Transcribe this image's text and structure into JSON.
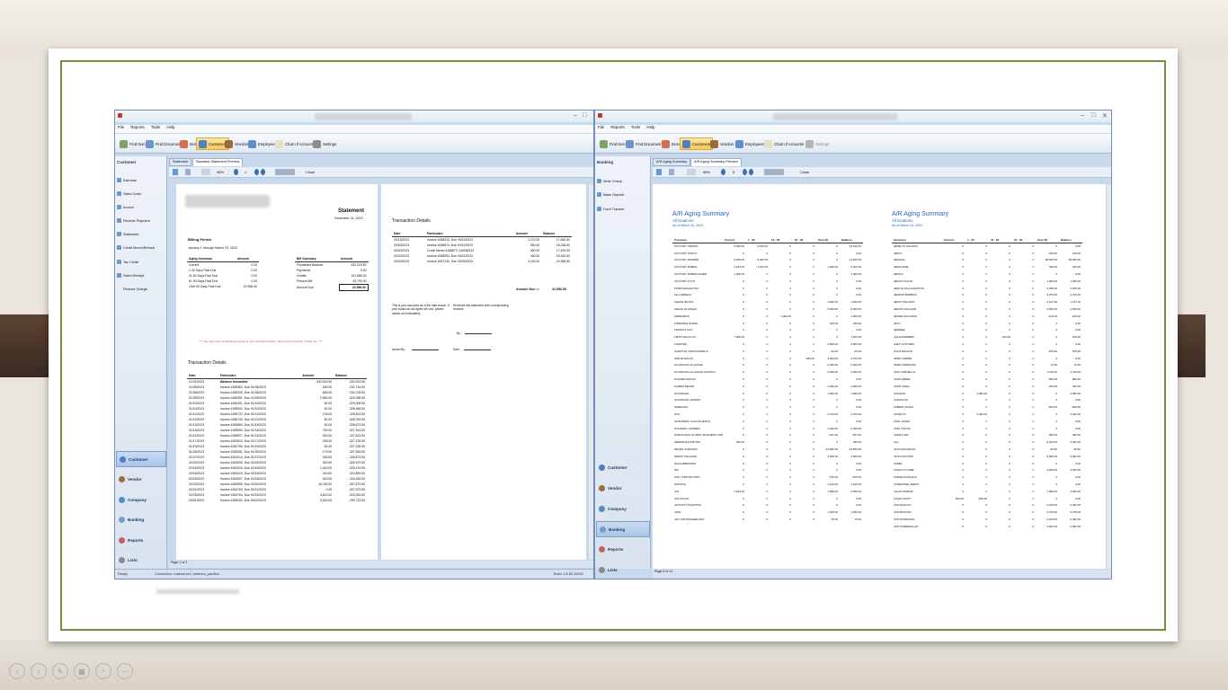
{
  "left_window": {
    "menu": [
      "File",
      "Reports",
      "Tools",
      "Help"
    ],
    "toolbar": [
      "Find Item",
      "Find Document",
      "Items",
      "Customers",
      "Vendors",
      "Employees",
      "Chart of Accounts",
      "Settings"
    ],
    "sidebar_title": "Customer",
    "sidebar_items": [
      "Estimate",
      "Sales Order",
      "Invoice",
      "Receive Payment",
      "Statement",
      "Credit Memo/Refund",
      "Tax Credit",
      "Sales Receipt",
      "Finance Charge"
    ],
    "nav": [
      "Customer",
      "Vendor",
      "Company",
      "Banking",
      "Reports",
      "Lists"
    ],
    "tabs": [
      "Statement",
      "Standard Statement Preview"
    ],
    "zoom": "98%",
    "page_num": "1",
    "close_label": "Close",
    "page_status": "Page 1 of 2",
    "status_ready": "Ready",
    "status_conn": "Connection: mainserver | acteneo_pacifica",
    "status_build": "Build: 4.6.50.10030"
  },
  "statement": {
    "title": "Statement",
    "date": "December 31, 2023",
    "billing_period_label": "Billing Period",
    "billing_period": "January 1 through March 24, 2023",
    "aging_header": [
      "Aging Summary",
      "Amount"
    ],
    "aging_rows": [
      [
        "Current",
        "0.00"
      ],
      [
        "1-30 Days Past Due",
        "0.00"
      ],
      [
        "31-60 Days Past Due",
        "0.00"
      ],
      [
        "61-90 Days Past Due",
        "0.00"
      ],
      [
        "Over 90 Days Past Due",
        "22,556.50"
      ]
    ],
    "bill_header": [
      "Bill Summary",
      "Amount"
    ],
    "bill_rows": [
      [
        "Forwarded Balance",
        "-332,923.50"
      ],
      [
        "Payments",
        "0.00"
      ],
      [
        "Credits",
        "-311,685.00"
      ],
      [
        "Present Bill",
        "43,795.00"
      ],
      [
        "Amount Due",
        "22,556.50"
      ]
    ],
    "warning": "*** You may have overlooked payment of your overdue invoices. This is just a reminder. Thank you. ***",
    "td_title": "Transaction Details",
    "td_header": [
      "Date",
      "Particulars",
      "Amount",
      "Balance"
    ],
    "td_rows": [
      [
        "01/01/2023",
        "Balance forwarded",
        "-332,923.50",
        "-332,923.50"
      ],
      [
        "01/05/2023",
        "Invoice #185363, Due 01/05/2023",
        "180.00",
        "-332,743.50"
      ],
      [
        "01/06/2023",
        "Invoice #185335, Due 01/06/2023",
        "665.00",
        "-332,078.50"
      ],
      [
        "01/09/2023",
        "Invoice #185391, Due 01/09/2023",
        "2,980.00",
        "-329,098.50"
      ],
      [
        "01/10/2023",
        "Invoice #185401, Due 01/10/2023",
        "90.00",
        "-329,008.50"
      ],
      [
        "01/10/2023",
        "Invoice #185542, Due 01/10/2023",
        "60.00",
        "-328,948.50"
      ],
      [
        "01/11/2023",
        "Invoice #185722, Due 01/11/2023",
        "135.00",
        "-328,813.50"
      ],
      [
        "01/12/2023",
        "Invoice #185740, Due 01/12/2023",
        "50.00",
        "-328,763.50"
      ],
      [
        "01/13/2023",
        "Invoice #185884, Due 01/13/2023",
        "90.00",
        "-328,673.50"
      ],
      [
        "01/14/2023",
        "Invoice #185950, Due 01/14/2023",
        "760.00",
        "-327,913.50"
      ],
      [
        "01/14/2023",
        "Invoice #185927, Due 01/14/2023",
        "300.00",
        "-327,613.50"
      ],
      [
        "01/17/2023",
        "Invoice #182610, Due 01/17/2023",
        "335.00",
        "-327,278.50"
      ],
      [
        "01/19/2023",
        "Invoice #182780, Due 01/19/2023",
        "50.00",
        "-327,228.50"
      ],
      [
        "01/26/2023",
        "Invoice #183281, Due 01/26/2023",
        "175.00",
        "-327,053.50"
      ],
      [
        "01/27/2023",
        "Invoice #183414, Due 01/27/2023",
        "180.00",
        "-326,873.50"
      ],
      [
        "02/02/2023",
        "Invoice #183535, Due 02/02/2023",
        "300.00",
        "-326,573.50"
      ],
      [
        "02/15/2023",
        "Invoice #184315, Due 02/15/2023",
        "1,440.00",
        "-325,133.50"
      ],
      [
        "02/16/2023",
        "Invoice #184415, Due 02/16/2023",
        "240.00",
        "-324,893.50"
      ],
      [
        "02/18/2023",
        "Invoice #184547, Due 02/18/2023",
        "440.00",
        "-324,453.50"
      ],
      [
        "02/20/2023",
        "Invoice #184595, Due 02/20/2023",
        "16,780.00",
        "-307,673.50"
      ],
      [
        "02/21/2023",
        "Invoice #184763, Due 02/21/2023",
        "0.00",
        "-307,673.50"
      ],
      [
        "02/23/2023",
        "Invoice #184764, Due 02/23/2023",
        "4,620.00",
        "-303,053.50"
      ],
      [
        "03/01/2023",
        "Invoice #185292, Due 03/01/2023",
        "3,340.00",
        "-299,713.50"
      ]
    ],
    "right_title": "Transaction Details",
    "right_header": [
      "Date",
      "Particulars",
      "Amount",
      "Balance"
    ],
    "right_rows": [
      [
        "03/13/2023",
        "Invoice #186313, Due 03/13/2023",
        "1,270.00",
        "17,646.50"
      ],
      [
        "03/20/2023",
        "Invoice #186870, Due 04/19/2023",
        "590.00",
        "18,236.50"
      ],
      [
        "03/20/2023",
        "Credit Memo #186870, DI#186313",
        "-360.00",
        "17,876.50"
      ],
      [
        "03/22/2023",
        "Invoice #186994, Due 04/21/2023",
        "440.00",
        "18,316.50"
      ],
      [
        "03/23/2023",
        "Invoice #187140, Due 03/23/2023",
        "4,240.00",
        "22,556.50"
      ]
    ],
    "amount_due_label": "Amount Due ->",
    "amount_due": "22,556.50",
    "note_left": "This is your accounts as of the date shown. If your books do not agree wit ours, please advise us immediately.",
    "note_right": "Received this statement with corresponding invoices",
    "by_label": "By:",
    "issued_label": "Issued By:",
    "date_label": "Date:"
  },
  "right_window": {
    "menu": [
      "File",
      "Reports",
      "Tools",
      "Help"
    ],
    "toolbar": [
      "Find Item",
      "Find Document",
      "Items",
      "Customers",
      "Vendors",
      "Employees",
      "Chart of Accounts",
      "Settings"
    ],
    "sidebar_title": "Banking",
    "sidebar_items": [
      "Write Check",
      "Make Deposit",
      "Fund Transfer"
    ],
    "nav": [
      "Customer",
      "Vendor",
      "Company",
      "Banking",
      "Reports",
      "Lists"
    ],
    "tabs": [
      "A/R Aging Summary",
      "A/R Aging Summary Preview"
    ],
    "zoom": "98%",
    "page_num": "5",
    "close_label": "Close",
    "page_status": "Page 5 of 11"
  },
  "aging_left": {
    "title": "A/R Aging Summary",
    "sub1": "All locations",
    "sub2": "As of March 24, 2023",
    "header": [
      "Customer",
      "Current",
      "1 - 30",
      "31 - 60",
      "61 - 90",
      "Over 90",
      "Balance"
    ],
    "rows": [
      [
        "FACTORY CEDING",
        "6,000.00",
        "9,100.00",
        "0",
        "0",
        "0",
        "15,100.00"
      ],
      [
        "FACTORY POPOY",
        "0",
        "0",
        "0",
        "0",
        "0",
        "0.00"
      ],
      [
        "FACTORY ROMMIE",
        "9,300.00",
        "5,300.00",
        "0",
        "0",
        "0",
        "14,600.00"
      ],
      [
        "FACTORY RUBEN",
        "2,100.00",
        "3,100.00",
        "0",
        "0",
        "1,000.00",
        "6,200.00"
      ],
      [
        "FACTORY RUBEN/JUNER",
        "1,000.00",
        "0",
        "0",
        "0",
        "0",
        "1,000.00"
      ],
      [
        "FACTORY TUYO",
        "0",
        "0",
        "0",
        "0",
        "0",
        "0.00"
      ],
      [
        "FARM MAGSAYSAY",
        "0",
        "0",
        "0",
        "0",
        "0",
        "0.00"
      ],
      [
        "FE LOBRECA",
        "0",
        "0",
        "0",
        "0",
        "0",
        "0.00"
      ],
      [
        "FELIPE REYES",
        "0",
        "0",
        "0",
        "0",
        "1,000.00",
        "1,000.00"
      ],
      [
        "FELIZA OLIVALEC",
        "0",
        "0",
        "0",
        "0",
        "-5,000.00",
        "-5,000.00"
      ],
      [
        "FERNANDO",
        "0",
        "0",
        "1,000.00",
        "0",
        "0",
        "1,000.00"
      ],
      [
        "FORDMAN ROMEL",
        "0",
        "0",
        "0",
        "0",
        "400.00",
        "400.00"
      ],
      [
        "FRANCIS CAO",
        "0",
        "0",
        "0",
        "0",
        "0",
        "0.00"
      ],
      [
        "FRITZ SAN AYLO",
        "7,000.00",
        "0",
        "0",
        "0",
        "0",
        "7,000.00"
      ],
      [
        "FUENTES",
        "0",
        "0",
        "0",
        "0",
        "2,800.00",
        "2,800.00"
      ],
      [
        "GAMUTIN, KRISTOFFER M",
        "0",
        "0",
        "0",
        "0",
        "-20.00",
        "-20.00"
      ],
      [
        "GIRLIE ARCAS",
        "0",
        "0",
        "0",
        "-330.00",
        "3,300.00",
        "2,970.00"
      ],
      [
        "GLANDANG ALLIANCE",
        "0",
        "0",
        "0",
        "0",
        "-2,300.00",
        "-2,300.00"
      ],
      [
        "GLANDANG ALLIANCE CHURCH",
        "0",
        "0",
        "0",
        "0",
        "6,250.00",
        "6,250.00"
      ],
      [
        "GOLDEN RANCH",
        "0",
        "0",
        "0",
        "0",
        "0",
        "0.00"
      ],
      [
        "GOMEZ FELIPE",
        "0",
        "0",
        "0",
        "0",
        "-1,000.00",
        "-1,000.00"
      ],
      [
        "GONZALES",
        "0",
        "0",
        "0",
        "0",
        "1,000.00",
        "1,000.00"
      ],
      [
        "GONZALES, RAMON",
        "0",
        "0",
        "0",
        "0",
        "0",
        "0.00"
      ],
      [
        "GREENGO",
        "0",
        "0",
        "0",
        "0",
        "0",
        "0.00"
      ],
      [
        "GSA",
        "0",
        "0",
        "0",
        "0",
        "3,700.00",
        "3,700.00"
      ],
      [
        "GUANTERO CLID PALIENTE",
        "0",
        "0",
        "0",
        "0",
        "0",
        "0.00"
      ],
      [
        "GUIVERIO, ANDREO",
        "0",
        "0",
        "0",
        "0",
        "2,400.00",
        "2,400.00"
      ],
      [
        "HARMI ASSA GLOBAL BUILDERS CORP.",
        "0",
        "0",
        "0",
        "0",
        "-927.50",
        "-927.50"
      ],
      [
        "HEEDINADA PRYNIA",
        "400.00",
        "0",
        "0",
        "0",
        "0",
        "400.00"
      ],
      [
        "HELEN CANDARO",
        "0",
        "0",
        "0",
        "0",
        "-14,850.00",
        "-14,850.00"
      ],
      [
        "HENRY SALAZAR",
        "0",
        "0",
        "0",
        "0",
        "3,000.00",
        "3,000.00"
      ],
      [
        "HILDA BRETANIA",
        "0",
        "0",
        "0",
        "0",
        "0",
        "0.00"
      ],
      [
        "HKI",
        "0",
        "0",
        "0",
        "0",
        "0",
        "0.00"
      ],
      [
        "HOLY PROTECTION",
        "0",
        "0",
        "0",
        "0",
        "-575.00",
        "-575.00"
      ],
      [
        "HOPSON",
        "0",
        "0",
        "0",
        "0",
        "1,100.00",
        "1,100.00"
      ],
      [
        "IAN",
        "1,100.00",
        "0",
        "0",
        "0",
        "1,800.00",
        "2,900.00"
      ],
      [
        "IAN PULOS",
        "0",
        "0",
        "0",
        "0",
        "0",
        "0.00"
      ],
      [
        "JACINTA TOLENTINO",
        "0",
        "0",
        "0",
        "0",
        "0",
        "0.00"
      ],
      [
        "JAKE",
        "0",
        "0",
        "0",
        "0",
        "1,250.00",
        "1,250.00"
      ],
      [
        "JAN JAN EVANGELISTA",
        "0",
        "0",
        "0",
        "0",
        "75.00",
        "75.00"
      ]
    ]
  },
  "aging_right": {
    "title": "A/R Aging Summary",
    "sub1": "All locations",
    "sub2": "As of March 24, 2023",
    "header": [
      "Customer",
      "Current",
      "1 - 30",
      "31 - 60",
      "61 - 90",
      "Over 90",
      "Balance"
    ],
    "rows": [
      [
        "JENELYN SALONIA",
        "0",
        "0",
        "0",
        "0",
        "0",
        "0.00"
      ],
      [
        "JERCY",
        "0",
        "0",
        "0",
        "0",
        "100.00",
        "100.00"
      ],
      [
        "JERADIA",
        "0",
        "0",
        "0",
        "0",
        "38,000.00",
        "38,000.00"
      ],
      [
        "JERALDINE",
        "0",
        "0",
        "0",
        "0",
        "400.00",
        "400.00"
      ],
      [
        "JERICK",
        "0",
        "0",
        "0",
        "0",
        "0",
        "0.00"
      ],
      [
        "JERICK DULYE",
        "0",
        "0",
        "0",
        "0",
        "1,000.00",
        "1,000.00"
      ],
      [
        "JERLYN FALCASANTOS",
        "0",
        "0",
        "0",
        "0",
        "2,465.00",
        "2,465.00"
      ],
      [
        "JERSON BARBON",
        "0",
        "0",
        "0",
        "0",
        "3,375.00",
        "3,375.00"
      ],
      [
        "JERVY PELIGRO",
        "0",
        "0",
        "0",
        "0",
        "1,137.00",
        "1,137.00"
      ],
      [
        "JERVIN SALAZAR",
        "0",
        "0",
        "0",
        "0",
        "1,500.00",
        "1,500.00"
      ],
      [
        "JESSIE SOLIAPAN",
        "0",
        "0",
        "0",
        "0",
        "-100.00",
        "-100.00"
      ],
      [
        "JETH",
        "0",
        "0",
        "0",
        "0",
        "0",
        "0.00"
      ],
      [
        "JEZREEL",
        "0",
        "0",
        "0",
        "0",
        "0",
        "0.00"
      ],
      [
        "JHA ESTEMBER",
        "0",
        "0",
        "100.00",
        "0",
        "0",
        "100.00"
      ],
      [
        "JHET GUTONES",
        "0",
        "0",
        "0",
        "0",
        "0",
        "0.00"
      ],
      [
        "JHUN BULAON",
        "0",
        "0",
        "0",
        "0",
        "875.00",
        "875.00"
      ],
      [
        "JIMMY FERRE",
        "0",
        "0",
        "0",
        "0",
        "0",
        "0.00"
      ],
      [
        "JIMMY PEDRONA",
        "0",
        "0",
        "0",
        "0",
        "11.00",
        "11.00"
      ],
      [
        "JING CORNELLO",
        "0",
        "0",
        "0",
        "0",
        "1,410.00",
        "1,410.00"
      ],
      [
        "JOAN ABREA",
        "0",
        "0",
        "0",
        "0",
        "800.00",
        "800.00"
      ],
      [
        "JOAN Chabe",
        "0",
        "0",
        "0",
        "0",
        "200.00",
        "200.00"
      ],
      [
        "JOAQUIN",
        "0",
        "1,065.00",
        "0",
        "0",
        "0",
        "1,065.00"
      ],
      [
        "JOAN/TAYA",
        "0",
        "0",
        "0",
        "0",
        "0",
        "0.00"
      ],
      [
        "JOBERT AGDIO",
        "0",
        "0",
        "0",
        "0",
        "-500.00",
        "-500.00"
      ],
      [
        "JOCELYN",
        "0",
        "2,200.00",
        "0",
        "0",
        "0",
        "2,200.00"
      ],
      [
        "JOEL JASON",
        "0",
        "0",
        "0",
        "0",
        "0",
        "0.00"
      ],
      [
        "JOEL TOLITE",
        "0",
        "0",
        "0",
        "0",
        "0",
        "0.00"
      ],
      [
        "JOEM LAZO",
        "0",
        "0",
        "0",
        "0",
        "280.00",
        "280.00"
      ],
      [
        "Jojo",
        "0",
        "0",
        "0",
        "0",
        "3,200.00",
        "3,200.00"
      ],
      [
        "JOJO ESCARLAN",
        "0",
        "0",
        "0",
        "0",
        "-99.50",
        "-99.50"
      ],
      [
        "JOJO FACTORY",
        "0",
        "0",
        "0",
        "0",
        "3,000.00",
        "3,000.00"
      ],
      [
        "JOMEL",
        "0",
        "0",
        "0",
        "0",
        "0",
        "0.00"
      ],
      [
        "JONALYN CABE",
        "0",
        "0",
        "0",
        "0",
        "3,250.00",
        "3,250.00"
      ],
      [
        "JORGE DUNGGAY",
        "0",
        "0",
        "0",
        "0",
        "0",
        "0.00"
      ],
      [
        "JOSEPHINE VERAS",
        "0",
        "0",
        "0",
        "0",
        "0",
        "0.00"
      ],
      [
        "JULAN MOROE",
        "0",
        "0",
        "0",
        "0",
        "1,000.00",
        "1,000.00"
      ],
      [
        "JULIET AGOT",
        "550.00",
        "-550.00",
        "0",
        "0",
        "0",
        "0.00"
      ],
      [
        "JUN ARAGCO",
        "0",
        "0",
        "0",
        "0",
        "2,200.00",
        "2,200.00"
      ],
      [
        "JUN BONOSA",
        "0",
        "0",
        "0",
        "0",
        "3,375.00",
        "3,375.00"
      ],
      [
        "JUN PAGDANAN",
        "0",
        "0",
        "0",
        "0",
        "-2,200.00",
        "-2,200.00"
      ],
      [
        "JUN TORDESILLAS",
        "0",
        "0",
        "0",
        "0",
        "2,500.00",
        "2,500.00"
      ]
    ]
  },
  "player_controls": [
    "prev-icon",
    "next-icon",
    "pen-icon",
    "slides-icon",
    "zoom-icon",
    "more-icon"
  ],
  "colors": {
    "accent_green": "#6f8f3a",
    "link_blue": "#2b63c4",
    "warning_red": "#d23a3a"
  }
}
